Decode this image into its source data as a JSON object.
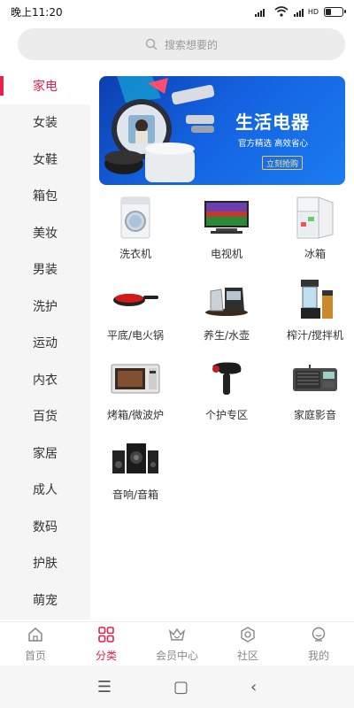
{
  "status": {
    "time": "晚上11:20",
    "hd": "HD"
  },
  "search": {
    "placeholder": "搜索想要的"
  },
  "sidebar": {
    "items": [
      {
        "label": "家电",
        "active": true
      },
      {
        "label": "女装"
      },
      {
        "label": "女鞋"
      },
      {
        "label": "箱包"
      },
      {
        "label": "美妆"
      },
      {
        "label": "男装"
      },
      {
        "label": "洗护"
      },
      {
        "label": "运动"
      },
      {
        "label": "内衣"
      },
      {
        "label": "百货"
      },
      {
        "label": "家居"
      },
      {
        "label": "成人"
      },
      {
        "label": "数码"
      },
      {
        "label": "护肤"
      },
      {
        "label": "萌宠"
      }
    ]
  },
  "banner": {
    "title": "生活电器",
    "subtitle": "官方精选 高效省心",
    "button": "立刻抢购"
  },
  "products": [
    {
      "label": "洗衣机",
      "icon": "washing-machine-icon"
    },
    {
      "label": "电视机",
      "icon": "tv-icon"
    },
    {
      "label": "冰箱",
      "icon": "fridge-icon"
    },
    {
      "label": "平底/电火锅",
      "icon": "pan-icon"
    },
    {
      "label": "养生/水壶",
      "icon": "kettle-icon"
    },
    {
      "label": "榨汁/搅拌机",
      "icon": "juicer-icon"
    },
    {
      "label": "烤箱/微波炉",
      "icon": "microwave-icon"
    },
    {
      "label": "个护专区",
      "icon": "hairdryer-icon"
    },
    {
      "label": "家庭影音",
      "icon": "radio-icon"
    },
    {
      "label": "音响/音箱",
      "icon": "speaker-icon"
    }
  ],
  "tabs": [
    {
      "label": "首页",
      "icon": "home-icon"
    },
    {
      "label": "分类",
      "icon": "category-icon",
      "active": true
    },
    {
      "label": "会员中心",
      "icon": "crown-icon"
    },
    {
      "label": "社区",
      "icon": "community-icon"
    },
    {
      "label": "我的",
      "icon": "profile-icon"
    }
  ],
  "colors": {
    "accent": "#e8214a",
    "banner": "#1462e0"
  }
}
